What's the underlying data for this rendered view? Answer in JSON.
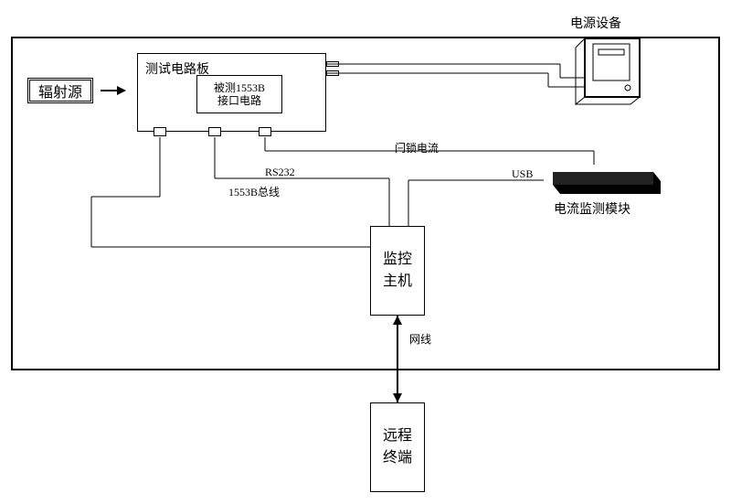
{
  "box_radiation_source": "辐射源",
  "box_test_board": "测试电路板",
  "box_dut_1553b_if": "被测1553B\n接口电路",
  "box_power_supply_caption": "电源设备",
  "box_current_monitor_caption": "电流监测模块",
  "box_monitor_host": "监控\n主机",
  "box_remote_terminal": "远程\n终端",
  "label_latch_current": "闩锁电流",
  "label_rs232": "RS232",
  "label_1553b_bus": "1553B总线",
  "label_usb": "USB",
  "label_net_cable": "网线"
}
